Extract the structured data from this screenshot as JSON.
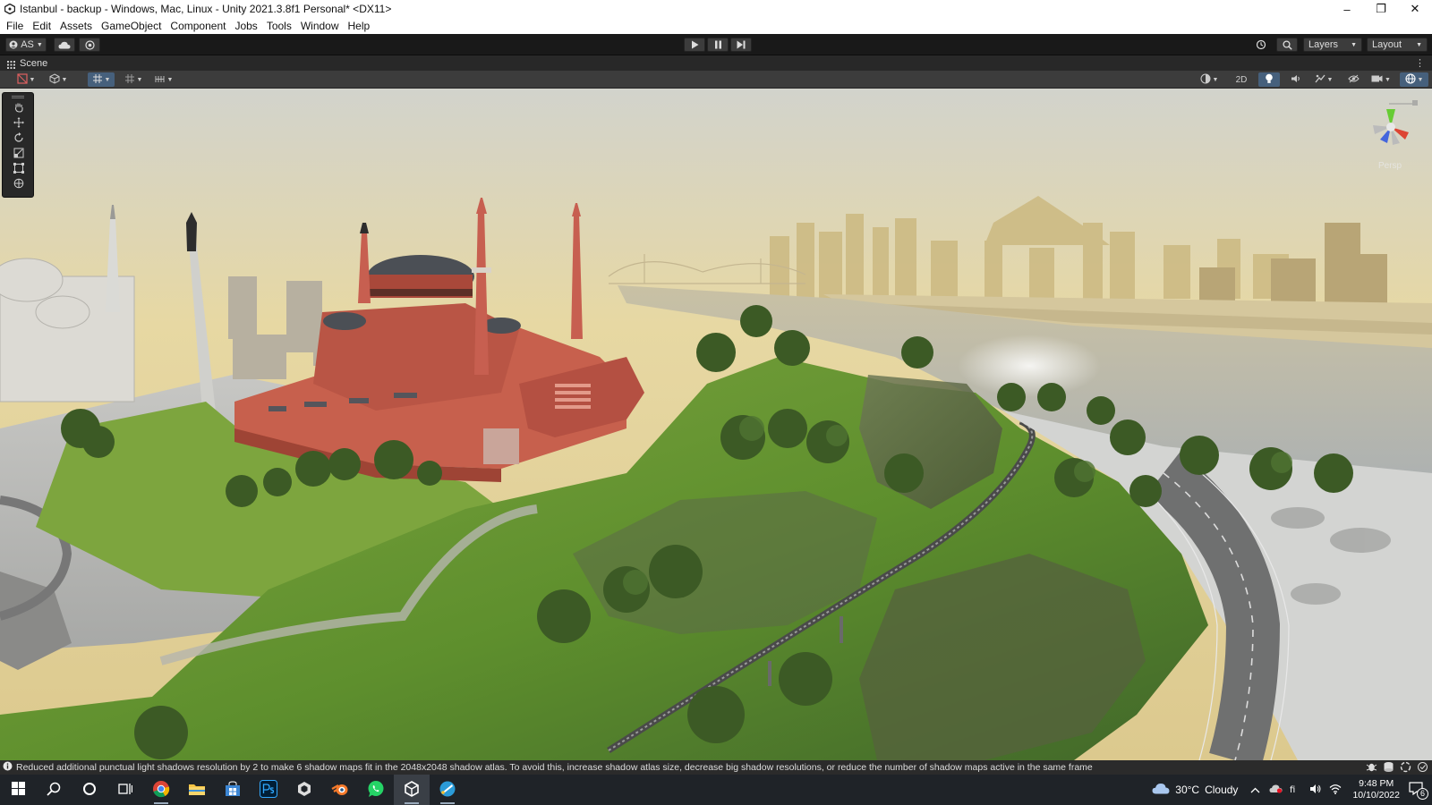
{
  "window": {
    "title": "Istanbul - backup - Windows, Mac, Linux - Unity 2021.3.8f1 Personal* <DX11>",
    "controls": [
      "minimize",
      "restore",
      "close"
    ]
  },
  "menu": {
    "items": [
      "File",
      "Edit",
      "Assets",
      "GameObject",
      "Component",
      "Jobs",
      "Tools",
      "Window",
      "Help"
    ]
  },
  "toolbar": {
    "account_label": "AS",
    "layers_label": "Layers",
    "layout_label": "Layout"
  },
  "scene_tab": {
    "label": "Scene"
  },
  "scene_toolbar": {
    "toggle_2d": "2D"
  },
  "gizmo": {
    "projection_label": "Persp"
  },
  "status": {
    "message": "Reduced additional punctual light shadows resolution by 2 to make 6 shadow maps fit in the 2048x2048 shadow atlas. To avoid this, increase shadow atlas size, decrease big shadow resolutions, or reduce the number of shadow maps active in the same frame"
  },
  "taskbar": {
    "weather_temp": "30°C",
    "weather_text": "Cloudy",
    "time": "9:48 PM",
    "date": "10/10/2022",
    "notification_count": "6"
  },
  "colors": {
    "editor_dark": "#191919",
    "panel": "#3c3c3c",
    "accent_active": "#46607c",
    "sky": "#e9dca6",
    "grass": "#6b9a37",
    "water": "#c9c5b8",
    "mosque": "#c5614f"
  }
}
